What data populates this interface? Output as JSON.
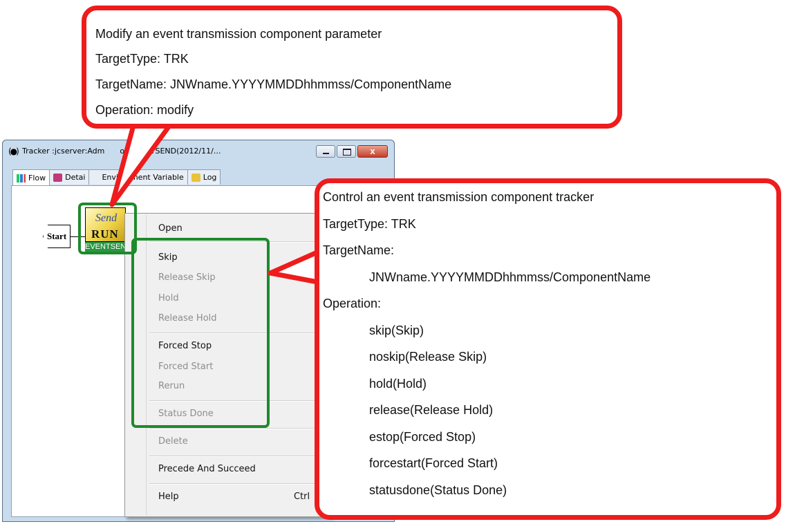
{
  "window": {
    "title": "Tracker :jcserver:Administrator:EVENTSEND(2012/11/...",
    "title_visible": "Tracker :jcserver:Adm",
    "title_tail": "or:EVENTSEND(2012/11/...",
    "close_glyph": "x",
    "tabs": [
      {
        "label": "Flow",
        "icon": "flow-icon",
        "active": true
      },
      {
        "label": "Detai",
        "icon": "detail-icon",
        "active": false
      },
      {
        "label": "Environment Variable",
        "icon": "environment-icon",
        "active": false
      },
      {
        "label": "Log",
        "icon": "log-icon",
        "active": false
      }
    ]
  },
  "flow": {
    "start_label": "Start",
    "job_icon_text": "RUN",
    "job_icon_script": "Send",
    "job_name": "EVENTSEND"
  },
  "context_menu": {
    "items": [
      {
        "label": "Open",
        "enabled": true
      },
      {
        "label": "Skip",
        "enabled": true
      },
      {
        "label": "Release Skip",
        "enabled": false
      },
      {
        "label": "Hold",
        "enabled": false
      },
      {
        "label": "Release Hold",
        "enabled": false
      },
      {
        "label": "Forced Stop",
        "enabled": true
      },
      {
        "label": "Forced Start",
        "enabled": false
      },
      {
        "label": "Rerun",
        "enabled": false
      },
      {
        "label": "Status Done",
        "enabled": false
      },
      {
        "label": "Delete",
        "enabled": false
      },
      {
        "label": "Precede And Succeed",
        "enabled": true
      },
      {
        "label": "Help",
        "enabled": true,
        "shortcut": "Ctrl"
      }
    ]
  },
  "callout_top": {
    "lines": [
      "Modify an event transmission component parameter",
      "TargetType: TRK",
      "TargetName: JNWname.YYYYMMDDhhmmss/ComponentName",
      "Operation: modify"
    ]
  },
  "callout_right": {
    "lines": [
      "Control an event transmission component tracker",
      "TargetType: TRK",
      "TargetName:",
      "JNWname.YYYYMMDDhhmmss/ComponentName",
      "Operation:",
      "skip(Skip)",
      "noskip(Release Skip)",
      "hold(Hold)",
      "release(Release Hold)",
      "estop(Forced Stop)",
      "forcestart(Forced Start)",
      "statusdone(Status Done)"
    ]
  },
  "colors": {
    "callout_border": "#ee1c1c",
    "highlight_border": "#1e8a2c",
    "window_frame": "#c9dcee",
    "menu_disabled_text": "#8d8d8d"
  }
}
